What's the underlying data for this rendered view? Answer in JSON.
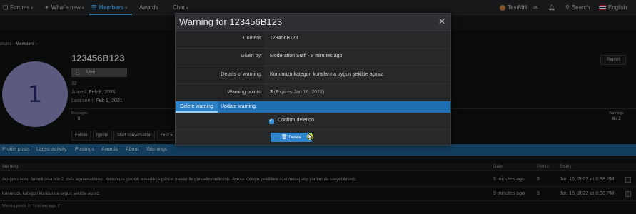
{
  "navbar": {
    "items": [
      {
        "label": "Forums",
        "icon": "chat-bubbles-icon"
      },
      {
        "label": "What's new",
        "icon": "lightbulb-icon"
      },
      {
        "label": "Members",
        "icon": "members-icon"
      },
      {
        "label": "Awards"
      },
      {
        "label": "Chat"
      }
    ],
    "user_name": "TestMH",
    "search_label": "Search",
    "language_label": "English",
    "accent_color": "#47a7eb"
  },
  "breadcrumb": {
    "prefix": "orums",
    "current": "Members"
  },
  "profile": {
    "avatar_letter": "1",
    "username": "123456B123",
    "user_title": "Üye",
    "custom_line": "32",
    "joined_label": "Joined:",
    "joined_value": "Feb 9, 2021",
    "last_seen_label": "Last seen:",
    "last_seen_value": "Feb 9, 2021",
    "report_label": "Report",
    "stats": {
      "messages_label": "Messages",
      "messages_value": "0",
      "warnings_label": "Warnings",
      "warnings_value": "6 / 2"
    },
    "actions": [
      "Follow",
      "Ignore",
      "Start conversation",
      "Find ▾"
    ]
  },
  "tabs": [
    "Profile posts",
    "Latest activity",
    "Postings",
    "Awards",
    "About",
    "Warnings"
  ],
  "warnings_table": {
    "headers": [
      "Warning",
      "Date",
      "Points",
      "Expiry"
    ],
    "rows": [
      {
        "warning": "Açtığınız konu önemli olsa bile 2. defa açmamalısınız. Konunuzu çok sık olmadıkça güncel mesajı ile güncelleyebilirsiniz. Ayrıca konuyu yetkililere özel mesaj atıp yardım da isteyebilirsiniz.",
        "date": "9 minutes ago",
        "points": "3",
        "expiry": "Jan 16, 2022 at 8:38 PM"
      },
      {
        "warning": "Konunuzu kategori kurallarına uygun şekilde açınız.",
        "date": "9 minutes ago",
        "points": "3",
        "expiry": "Jan 16, 2022 at 8:38 PM"
      }
    ],
    "footer": "Warning points: 6 · Total warnings: 2"
  },
  "modal": {
    "title": "Warning for 123456B123",
    "close_icon": "close-icon",
    "fields": [
      {
        "label": "Content:",
        "value": "123456B123"
      },
      {
        "label": "Given by:",
        "value": "Moderation Staff · 9 minutes ago"
      },
      {
        "label": "Details of warning:",
        "value": "Konunuzu kategori kurallarına uygun şekilde açınız."
      },
      {
        "label": "Warning points:",
        "value_strong": "3",
        "value_extra": "(Expires Jan 16, 2022)"
      }
    ],
    "tabs": [
      "Delete warning",
      "Update warning"
    ],
    "confirm_label": "Confirm deletion",
    "confirm_checked": true,
    "delete_label": "Delete",
    "primary_color": "#2f84cc"
  }
}
